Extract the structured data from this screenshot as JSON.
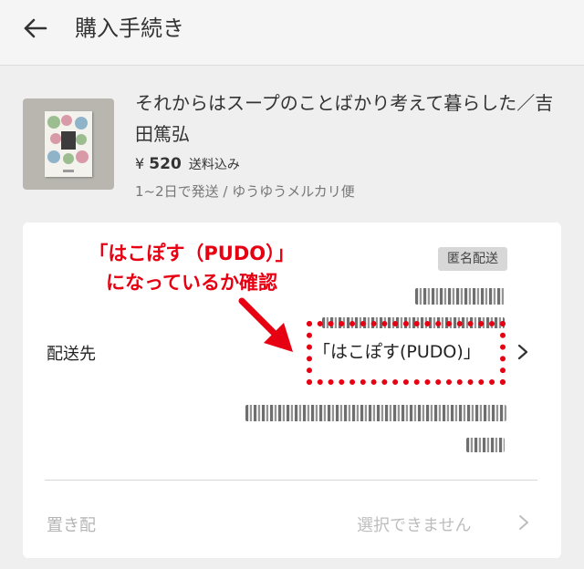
{
  "header": {
    "title": "購入手続き",
    "back_icon": "arrow-left-icon"
  },
  "item": {
    "title": "それからはスープのことばかり考えて暮らした／吉田篤弘",
    "currency": "¥",
    "price": "520",
    "price_note": "送料込み",
    "shipping": "1~2日で発送 / ゆうゆうメルカリ便"
  },
  "delivery": {
    "badge": "匿名配送",
    "label": "配送先",
    "value": "「はこぽす(PUDO)」",
    "chevron_icon": "chevron-right-icon"
  },
  "okihai": {
    "label": "置き配",
    "value": "選択できません",
    "chevron_icon": "chevron-right-icon"
  },
  "annotation": {
    "line1": "「はこぽす（PUDO）」",
    "line2": "になっているか確認",
    "color": "#e60012"
  }
}
